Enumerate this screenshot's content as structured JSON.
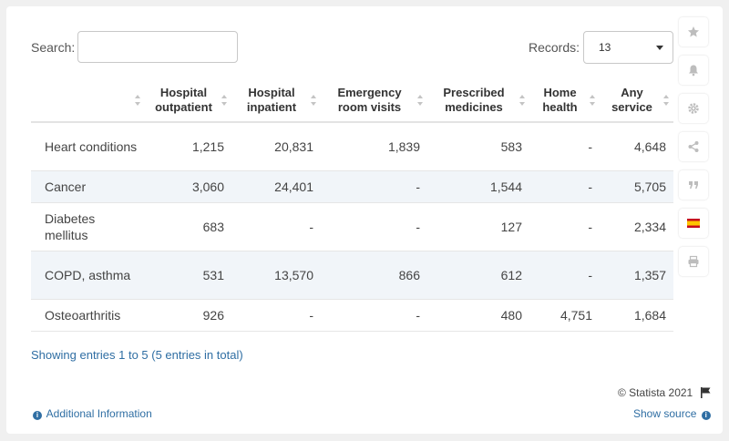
{
  "search": {
    "label": "Search:",
    "value": ""
  },
  "records": {
    "label": "Records:",
    "value": "13"
  },
  "table": {
    "headers": [
      {
        "l1": "",
        "l2": ""
      },
      {
        "l1": "Hospital",
        "l2": "outpatient"
      },
      {
        "l1": "Hospital",
        "l2": "inpatient"
      },
      {
        "l1": "Emergency",
        "l2": "room visits"
      },
      {
        "l1": "Prescribed",
        "l2": "medicines"
      },
      {
        "l1": "Home",
        "l2": "health"
      },
      {
        "l1": "Any",
        "l2": "service"
      }
    ],
    "rows": [
      {
        "c": [
          "Heart conditions",
          "1,215",
          "20,831",
          "1,839",
          "583",
          "-",
          "4,648"
        ]
      },
      {
        "c": [
          "Cancer",
          "3,060",
          "24,401",
          "-",
          "1,544",
          "-",
          "5,705"
        ]
      },
      {
        "c": [
          "Diabetes mellitus",
          "683",
          "-",
          "-",
          "127",
          "-",
          "2,334"
        ]
      },
      {
        "c": [
          "COPD, asthma",
          "531",
          "13,570",
          "866",
          "612",
          "-",
          "1,357"
        ]
      },
      {
        "c": [
          "Osteoarthritis",
          "926",
          "-",
          "-",
          "480",
          "4,751",
          "1,684"
        ]
      }
    ]
  },
  "footer": {
    "entries_info": "Showing entries 1 to 5 (5 entries in total)",
    "copyright": "© Statista 2021",
    "additional_info": "Additional Information",
    "show_source": "Show source"
  },
  "sidebar": {
    "icons": [
      "star-icon",
      "bell-icon",
      "gear-icon",
      "share-icon",
      "quote-icon",
      "spain-flag-icon",
      "print-icon"
    ]
  },
  "colors": {
    "link": "#2f6ea3",
    "row_alt": "#f1f5f9",
    "flag_red": "#c60b1e",
    "flag_yellow": "#ffc400"
  }
}
